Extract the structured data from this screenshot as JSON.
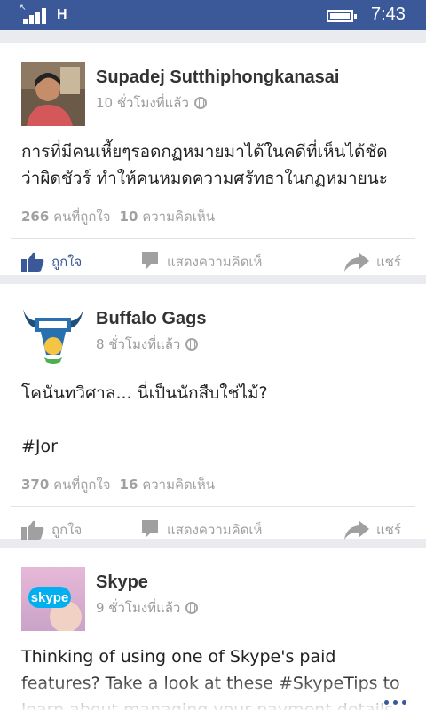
{
  "status_bar": {
    "network": "H",
    "time": "7:43"
  },
  "posts": [
    {
      "author": "Supadej Sutthiphongkanasai",
      "time": "10 ชั่วโมงที่แล้ว",
      "text": "การที่มีคนเหี้ยๆรอดกฏหมายมาได้ในคดีที่เห็นได้ชัดว่าผิดชัวร์ ทำให้คนหมดความศรัทธาในกฏหมายนะ",
      "likes_count": "266",
      "likes_label": "คนที่ถูกใจ",
      "comments_count": "10",
      "comments_label": "ความคิดเห็น",
      "like_label": "ถูกใจ",
      "liked": true,
      "comment_label": "แสดงความคิดเห็",
      "share_label": "แชร์"
    },
    {
      "author": "Buffalo Gags",
      "time": "8 ชั่วโมงที่แล้ว",
      "text": "โคนันทวิศาล... นี่เป็นนักสืบใช่ไม้?\n\n#Jor",
      "likes_count": "370",
      "likes_label": "คนที่ถูกใจ",
      "comments_count": "16",
      "comments_label": "ความคิดเห็น",
      "like_label": "ถูกใจ",
      "liked": false,
      "comment_label": "แสดงความคิดเห็",
      "share_label": "แชร์"
    },
    {
      "author": "Skype",
      "time": "9 ชั่วโมงที่แล้ว",
      "text": "Thinking of using one of Skype's paid features? Take a look at these #SkypeTips to learn about managing your payment details",
      "avatar_text": "skype"
    }
  ],
  "colors": {
    "brand": "#3b5998",
    "skype": "#00aff0"
  }
}
